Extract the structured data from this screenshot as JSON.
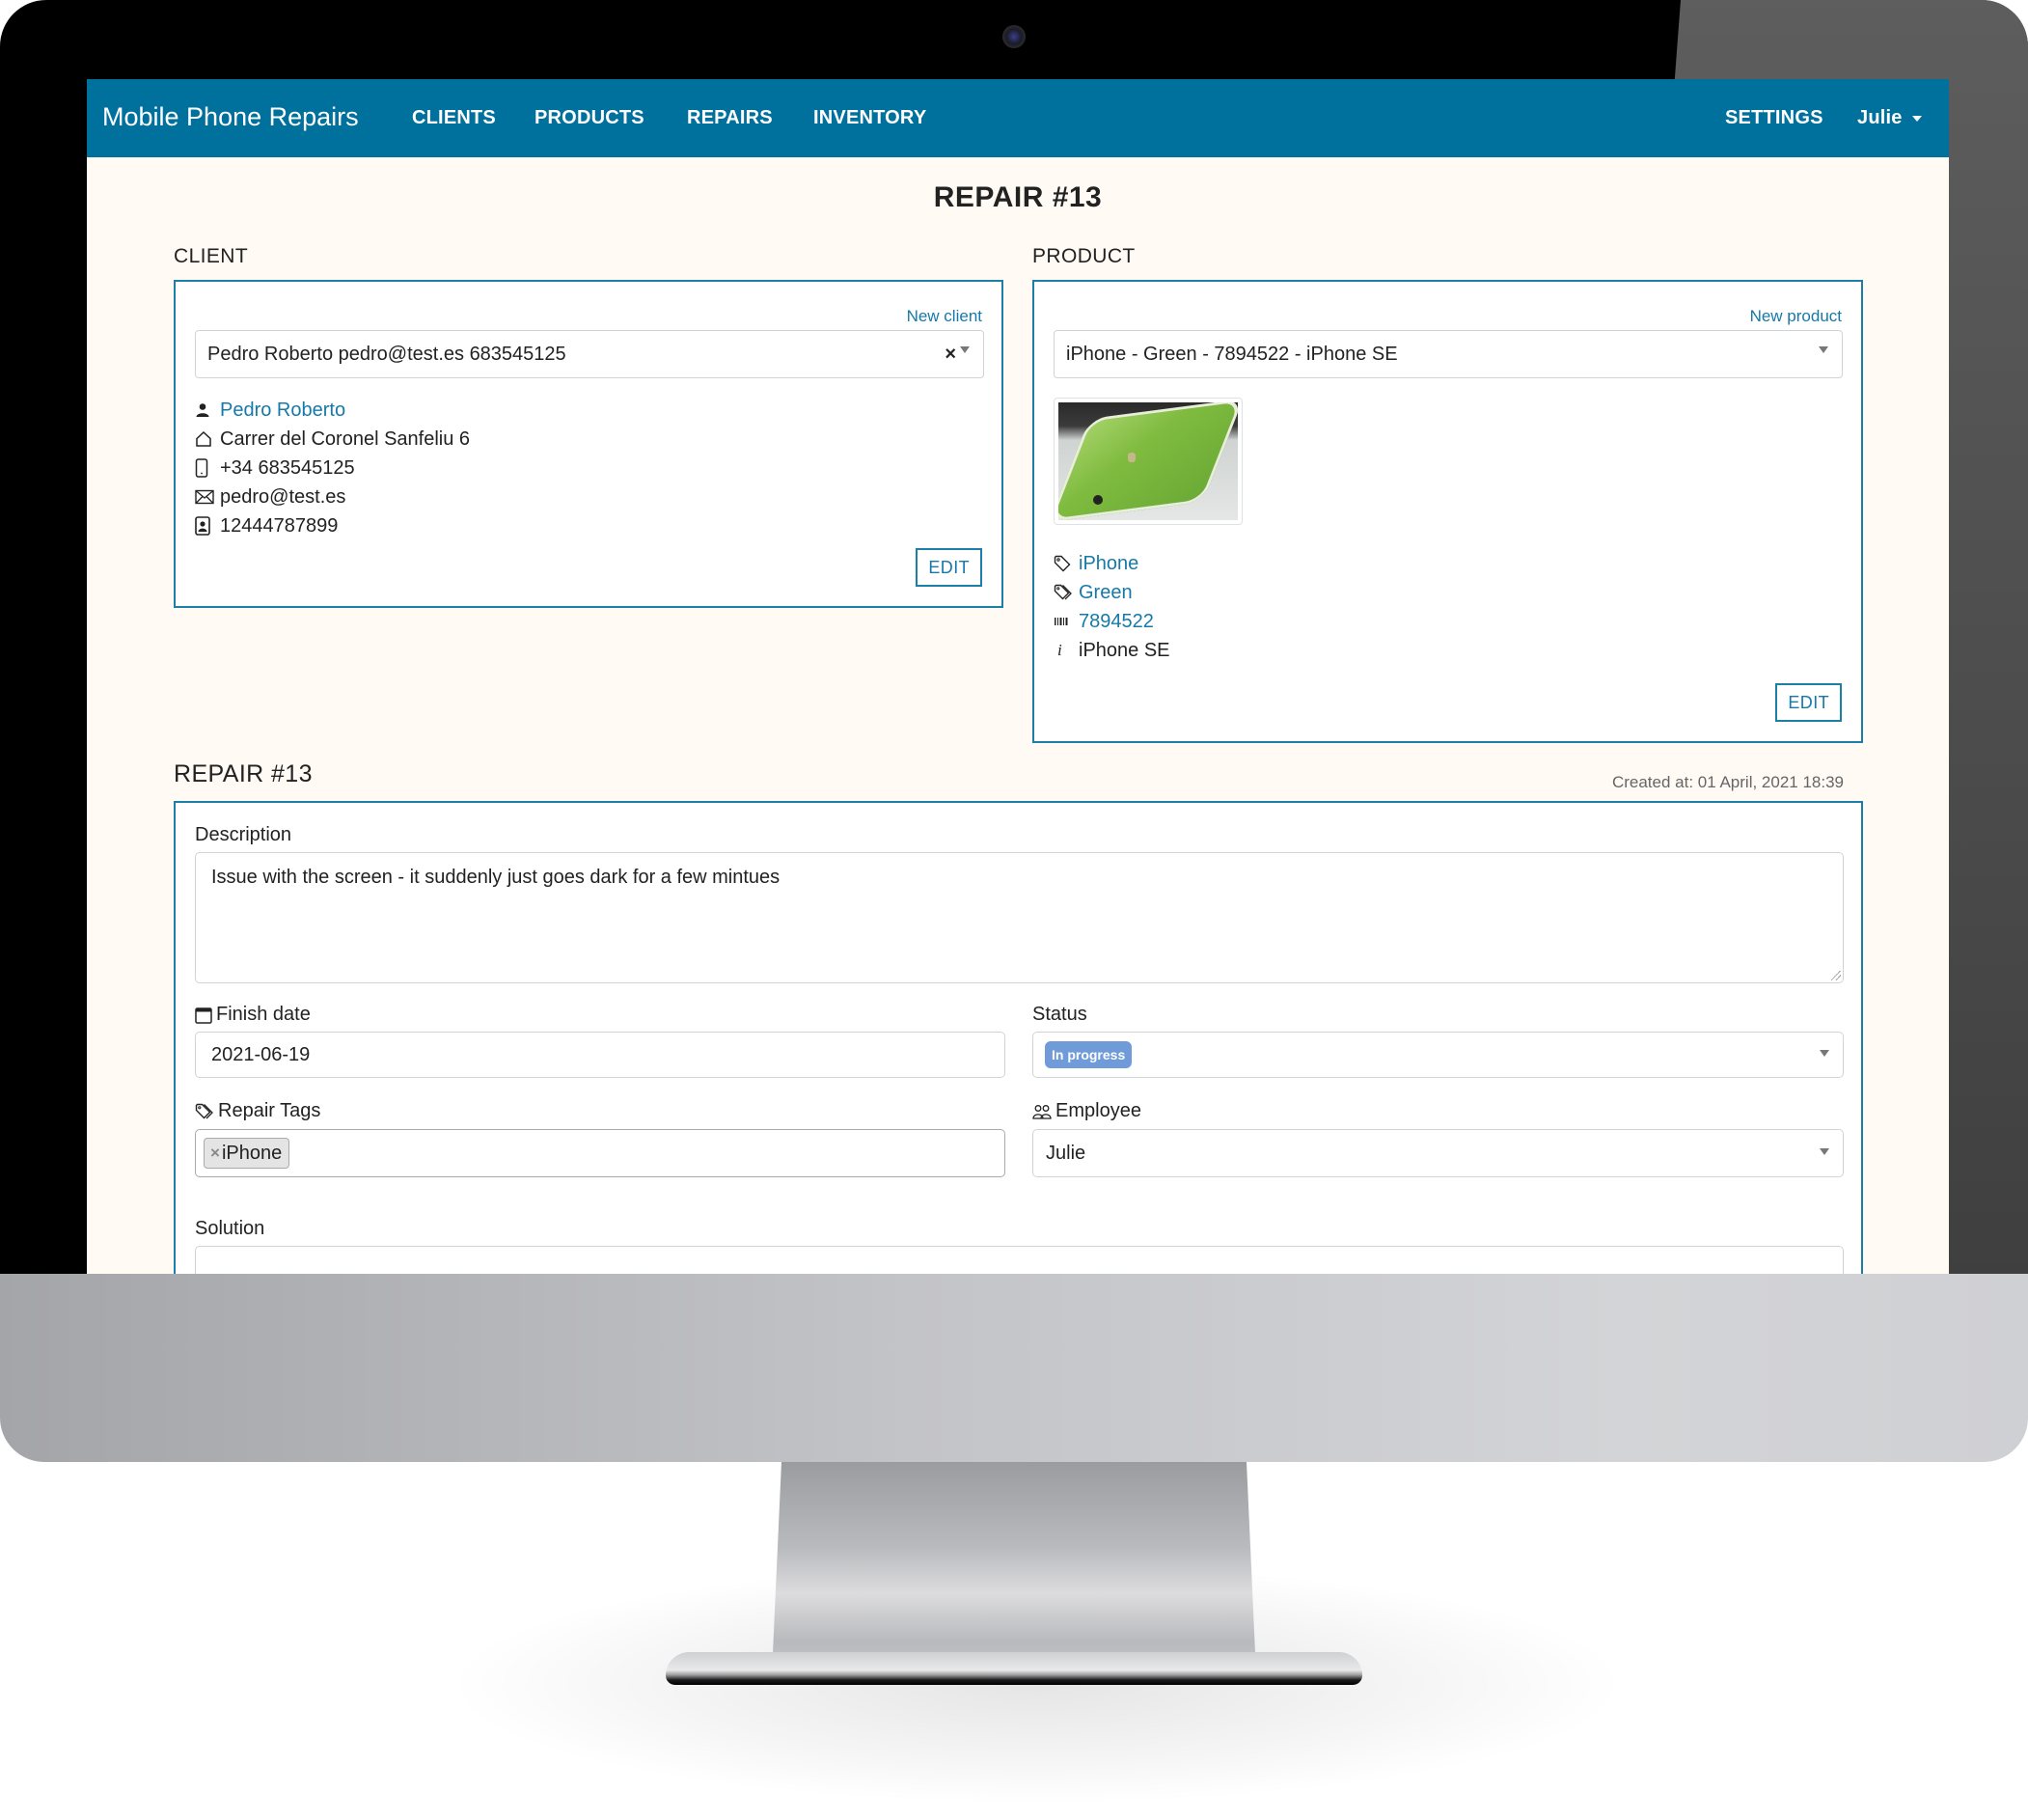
{
  "navbar": {
    "brand": "Mobile Phone Repairs",
    "items": [
      {
        "label": "CLIENTS"
      },
      {
        "label": "PRODUCTS"
      },
      {
        "label": "REPAIRS"
      },
      {
        "label": "INVENTORY"
      }
    ],
    "settings_label": "SETTINGS",
    "user_label": "Julie"
  },
  "page_title": "REPAIR #13",
  "client": {
    "section_label": "CLIENT",
    "new_link": "New client",
    "select_value": "Pedro Roberto pedro@test.es 683545125",
    "clear_symbol": "×",
    "details": {
      "name": "Pedro Roberto",
      "address": "Carrer del Coronel Sanfeliu 6",
      "phone": "+34 683545125",
      "email": "pedro@test.es",
      "id_number": "12444787899"
    },
    "edit_label": "EDIT"
  },
  "product": {
    "section_label": "PRODUCT",
    "new_link": "New product",
    "select_value": "iPhone - Green - 7894522 - iPhone SE",
    "details": {
      "brand": "iPhone",
      "color": "Green",
      "serial": "7894522",
      "model": "iPhone SE"
    },
    "edit_label": "EDIT"
  },
  "repair": {
    "section_label": "REPAIR #13",
    "created_at": "Created at: 01 April, 2021 18:39",
    "description_label": "Description",
    "description_value": "Issue with the screen - it suddenly just goes dark for a few mintues",
    "finish_date_label": "Finish date",
    "finish_date_value": "2021-06-19",
    "status_label": "Status",
    "status_value": "In progress",
    "status_color": "#6f9bd8",
    "tags_label": "Repair Tags",
    "tags": [
      {
        "label": "iPhone",
        "remove_symbol": "×"
      }
    ],
    "employee_label": "Employee",
    "employee_value": "Julie",
    "solution_label": "Solution",
    "solution_value": ""
  },
  "colors": {
    "navbar": "#00709d",
    "accent": "#1679a9",
    "page_background": "#fffaf3"
  }
}
